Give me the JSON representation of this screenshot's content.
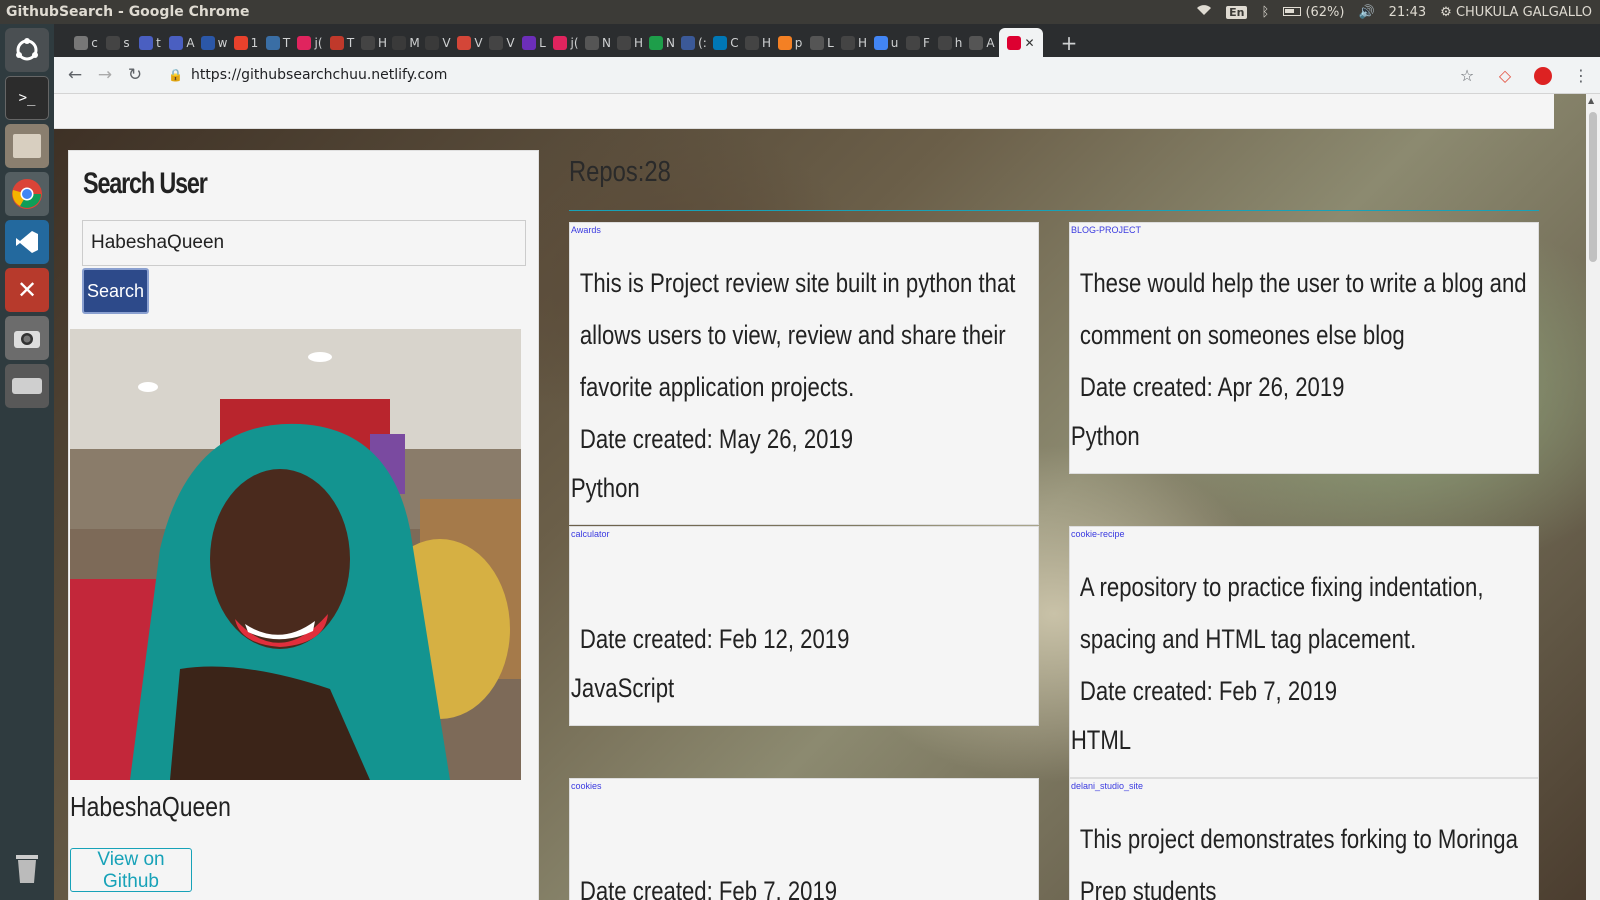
{
  "topbar": {
    "window_title": "GithubSearch - Google Chrome",
    "keyboard": "En",
    "battery": "(62%)",
    "time": "21:43",
    "user": "CHUKULA GALGALLO"
  },
  "launcher": {
    "items": [
      "ubuntu-dash-icon",
      "terminal-icon",
      "files-icon",
      "chrome-icon",
      "vscode-icon",
      "settings-tools-icon",
      "screenshot-camera-icon",
      "drive-icon"
    ],
    "trash": "trash-icon"
  },
  "tabs": [
    {
      "letter": "c",
      "color": "#777"
    },
    {
      "letter": "s",
      "color": "#444"
    },
    {
      "letter": "t",
      "color": "#4a5fc1"
    },
    {
      "letter": "A",
      "color": "#4a5fc1"
    },
    {
      "letter": "w",
      "color": "#2b57a8"
    },
    {
      "letter": "1",
      "color": "#e8412c"
    },
    {
      "letter": "T",
      "color": "#3a6ea5"
    },
    {
      "letter": "j(",
      "color": "#e0245e"
    },
    {
      "letter": "T",
      "color": "#c0392b"
    },
    {
      "letter": "H",
      "color": "#444"
    },
    {
      "letter": "M",
      "color": "#3a3a3a"
    },
    {
      "letter": "V",
      "color": "#3a3a3a"
    },
    {
      "letter": "V",
      "color": "#d44638"
    },
    {
      "letter": "V",
      "color": "#444"
    },
    {
      "letter": "L",
      "color": "#6c2eb9"
    },
    {
      "letter": "j(",
      "color": "#e0245e"
    },
    {
      "letter": "N",
      "color": "#555"
    },
    {
      "letter": "H",
      "color": "#444"
    },
    {
      "letter": "N",
      "color": "#1e9e4a"
    },
    {
      "letter": "(:",
      "color": "#3b5998"
    },
    {
      "letter": "C",
      "color": "#0077b5"
    },
    {
      "letter": "H",
      "color": "#444"
    },
    {
      "letter": "p",
      "color": "#f48024"
    },
    {
      "letter": "L",
      "color": "#555"
    },
    {
      "letter": "H",
      "color": "#444"
    },
    {
      "letter": "u",
      "color": "#4285f4"
    },
    {
      "letter": "F",
      "color": "#444"
    },
    {
      "letter": "h",
      "color": "#444"
    },
    {
      "letter": "A",
      "color": "#555"
    }
  ],
  "active_tab": {
    "icon": "angular-icon",
    "color": "#dd0031"
  },
  "toolbar": {
    "url": "https://githubsearchchuu.netlify.com"
  },
  "search": {
    "heading": "Search User",
    "value": "HabeshaQueen",
    "button": "Search"
  },
  "profile": {
    "username": "HabeshaQueen",
    "github_button": "View on Github"
  },
  "repos": {
    "heading": "Repos:28",
    "items": [
      {
        "name": "Awards",
        "description": "This is Project review site built in python that allows users to view, review and share their favorite application projects.",
        "date": "Date created: May 26, 2019",
        "language": "Python"
      },
      {
        "name": "BLOG-PROJECT",
        "description": "These would help the user to write a blog and comment on someones else blog",
        "date": "Date created: Apr 26, 2019",
        "language": "Python"
      },
      {
        "name": "calculator",
        "description": "",
        "date": "Date created: Feb 12, 2019",
        "language": "JavaScript"
      },
      {
        "name": "cookie-recipe",
        "description": "A repository to practice fixing indentation, spacing and HTML tag placement.",
        "date": "Date created: Feb 7, 2019",
        "language": "HTML"
      },
      {
        "name": "cookies",
        "description": "",
        "date": "Date created: Feb 7, 2019",
        "language": ""
      },
      {
        "name": "delani_studio_site",
        "description": "This project demonstrates forking to Moringa Prep students",
        "date": "",
        "language": ""
      }
    ]
  },
  "colors": {
    "accent": "#17a2b8",
    "search_button": "#2d4a8a",
    "repo_link": "#3a3ae0"
  }
}
